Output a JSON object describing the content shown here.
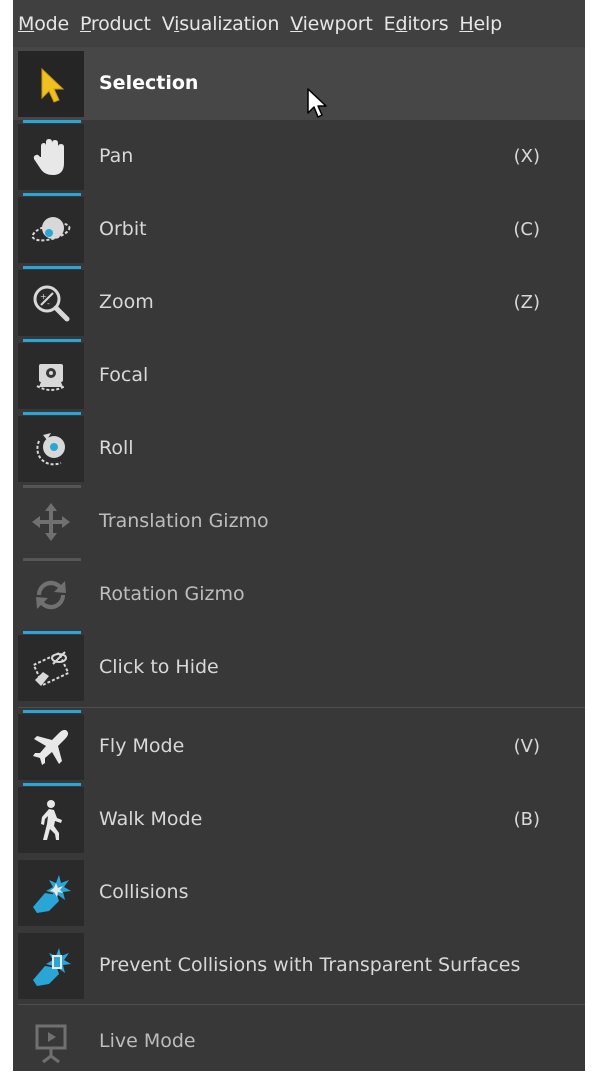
{
  "menubar": {
    "items": [
      {
        "pre": "",
        "ul": "M",
        "post": "ode"
      },
      {
        "pre": "",
        "ul": "P",
        "post": "roduct"
      },
      {
        "pre": "V",
        "ul": "i",
        "post": "sualization"
      },
      {
        "pre": "",
        "ul": "V",
        "post": "iewport"
      },
      {
        "pre": "E",
        "ul": "d",
        "post": "itors"
      },
      {
        "pre": "",
        "ul": "H",
        "post": "elp"
      }
    ]
  },
  "mode_menu": {
    "items": [
      {
        "label": "Selection",
        "shortcut": "",
        "icon": "arrow-cursor-icon"
      },
      {
        "label": "Pan",
        "shortcut": "(X)",
        "icon": "hand-icon"
      },
      {
        "label": "Orbit",
        "shortcut": "(C)",
        "icon": "orbit-icon"
      },
      {
        "label": "Zoom",
        "shortcut": "(Z)",
        "icon": "zoom-icon"
      },
      {
        "label": "Focal",
        "shortcut": "",
        "icon": "focal-icon"
      },
      {
        "label": "Roll",
        "shortcut": "",
        "icon": "roll-icon"
      },
      {
        "label": "Translation Gizmo",
        "shortcut": "",
        "icon": "translation-gizmo-icon"
      },
      {
        "label": "Rotation Gizmo",
        "shortcut": "",
        "icon": "rotation-gizmo-icon"
      },
      {
        "label": "Click to Hide",
        "shortcut": "",
        "icon": "click-to-hide-icon"
      },
      {
        "label": "Fly Mode",
        "shortcut": "(V)",
        "icon": "airplane-icon"
      },
      {
        "label": "Walk Mode",
        "shortcut": "(B)",
        "icon": "walking-person-icon"
      },
      {
        "label": "Collisions",
        "shortcut": "",
        "icon": "collision-icon"
      },
      {
        "label": "Prevent Collisions with Transparent Surfaces",
        "shortcut": "",
        "icon": "transparent-collision-icon"
      },
      {
        "label": "Live Mode",
        "shortcut": "",
        "icon": "presentation-screen-icon"
      }
    ]
  },
  "colors": {
    "background": "#383838",
    "accent": "#2aa6d6",
    "selection_icon": "#f0c020",
    "text": "#d8d8d8"
  }
}
